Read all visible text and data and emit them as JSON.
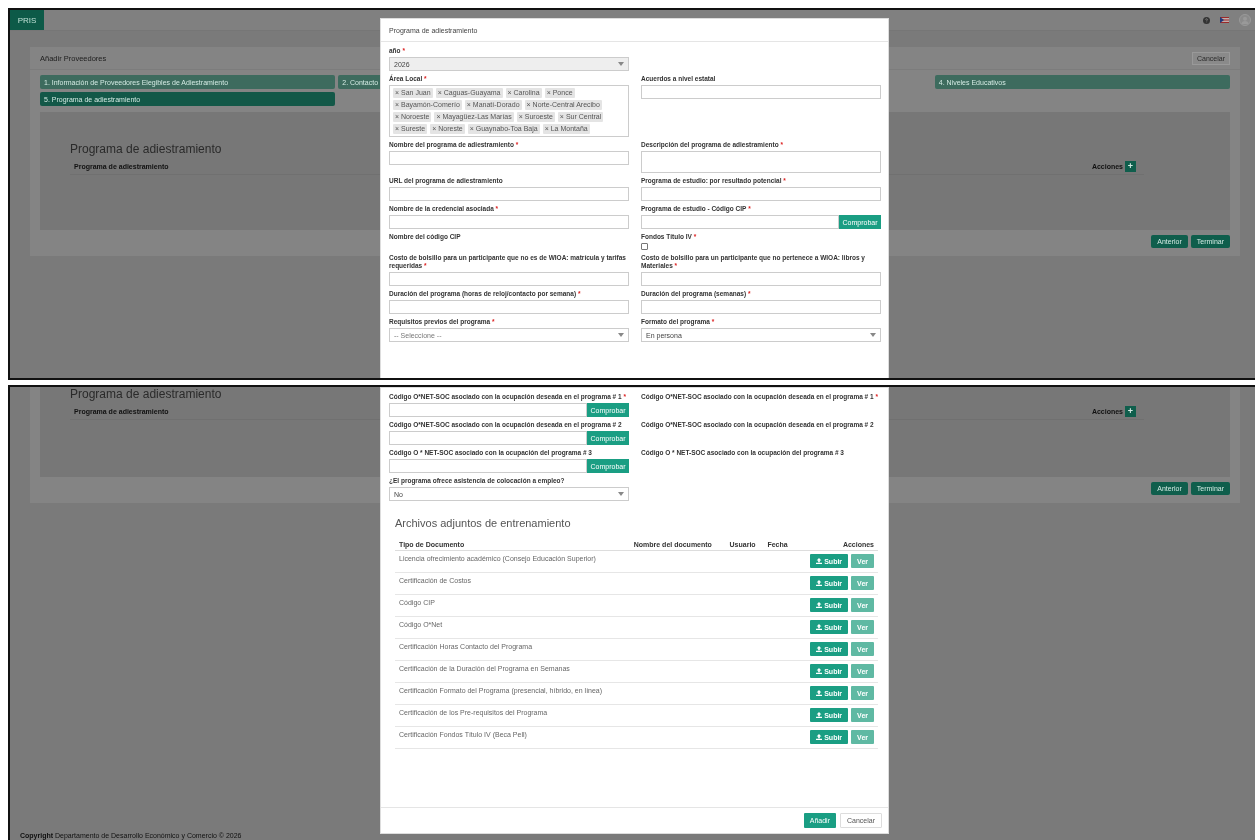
{
  "top_screen": {
    "navbar": {
      "brand": "PRIS"
    },
    "page": {
      "title": "Añadir Proveedores",
      "cancel_button": "Cancelar",
      "steps": [
        {
          "label": "1. Información de Proveedores Elegibles de Adiestramiento",
          "selected": false
        },
        {
          "label": "2. Contacto",
          "selected": false
        },
        {
          "label": "4. Niveles Educativos",
          "selected": false
        },
        {
          "label": "5. Programa de adiestramiento",
          "selected": true
        }
      ],
      "section_title": "Programa de adiestramiento",
      "table_header": "Programa de adiestramiento",
      "actions_label": "Acciones",
      "add_button": "+",
      "buttons": [
        "Anterior",
        "Terminar"
      ]
    },
    "modal": {
      "title": "Programa de adiestramiento",
      "rows": [
        {
          "fields": [
            {
              "kind": "select",
              "label": "año",
              "mark": "*",
              "value": "2026",
              "disabled": true
            }
          ]
        },
        {
          "fields": [
            {
              "kind": "tags",
              "label": "Área Local",
              "mark": "*",
              "tags": [
                {
                  "remove": "×",
                  "label": "San Juan"
                },
                {
                  "remove": "×",
                  "label": "Caguas-Guayama"
                },
                {
                  "remove": "×",
                  "label": "Carolina"
                },
                {
                  "remove": "×",
                  "label": "Ponce"
                },
                {
                  "remove": "×",
                  "label": "Bayamón-Comerío"
                },
                {
                  "remove": "×",
                  "label": "Manatí-Dorado"
                },
                {
                  "remove": "×",
                  "label": "Norte-Central Arecibo"
                },
                {
                  "remove": "×",
                  "label": "Noroeste"
                },
                {
                  "remove": "×",
                  "label": "Mayagüez-Las Marías"
                },
                {
                  "remove": "×",
                  "label": "Suroeste"
                },
                {
                  "remove": "×",
                  "label": "Sur Central"
                },
                {
                  "remove": "×",
                  "label": "Sureste"
                },
                {
                  "remove": "×",
                  "label": "Noreste"
                },
                {
                  "remove": "×",
                  "label": "Guaynabo-Toa Baja"
                },
                {
                  "remove": "×",
                  "label": "La Montaña"
                }
              ]
            },
            {
              "kind": "text",
              "label": "Acuerdos a nivel estatal"
            }
          ]
        },
        {
          "fields": [
            {
              "kind": "text",
              "label": "Nombre del programa de adiestramiento",
              "mark": "*"
            },
            {
              "kind": "textarea",
              "label": "Descripción del programa de adiestramiento",
              "mark": "*"
            }
          ]
        },
        {
          "fields": [
            {
              "kind": "text",
              "label": "URL del programa de adiestramiento"
            },
            {
              "kind": "text",
              "label": "Programa de estudio: por resultado potencial",
              "mark": "*"
            }
          ]
        },
        {
          "fields": [
            {
              "kind": "text",
              "label": "Nombre de la credencial asociada",
              "mark": "*"
            },
            {
              "kind": "text_button",
              "label": "Programa de estudio - Código CIP",
              "mark": "*",
              "button": "Comprobar"
            }
          ]
        },
        {
          "fields": [
            {
              "kind": "label",
              "label": "Nombre del código CIP"
            },
            {
              "kind": "checkbox",
              "label": "Fondos Título IV",
              "mark": "*",
              "checked": false
            }
          ]
        },
        {
          "fields": [
            {
              "kind": "text",
              "label": "Costo de bolsillo para un participante que no es de WIOA: matrícula y tarifas requeridas",
              "mark": "*"
            },
            {
              "kind": "text",
              "label": "Costo de bolsillo para un participante que no pertenece a WIOA: libros y Materiales",
              "mark": "*"
            }
          ]
        },
        {
          "fields": [
            {
              "kind": "text",
              "label": "Duración del programa (horas de reloj/contacto por semana)",
              "mark": "*"
            },
            {
              "kind": "text",
              "label": "Duración del programa (semanas)",
              "mark": "*"
            }
          ]
        },
        {
          "fields": [
            {
              "kind": "select",
              "label": "Requisitos previos del programa",
              "mark": "*",
              "placeholder": "-- Seleccione --"
            },
            {
              "kind": "select",
              "label": "Formato del programa",
              "mark": "*",
              "value": "En persona"
            }
          ]
        }
      ]
    }
  },
  "bottom_screen": {
    "page": {
      "section_title": "Programa de adiestramiento",
      "table_header": "Programa de adiestramiento",
      "actions_label": "Acciones",
      "add_button": "+",
      "buttons": [
        "Anterior",
        "Terminar"
      ]
    },
    "modal": {
      "rows": [
        {
          "fields": [
            {
              "kind": "text_button",
              "label": "Código O*NET-SOC asociado con la ocupación deseada en el programa # 1",
              "mark": "*",
              "button": "Comprobar"
            },
            {
              "kind": "label",
              "label": "Código O*NET-SOC asociado con la ocupación deseada en el programa # 1",
              "mark": "*"
            }
          ]
        },
        {
          "fields": [
            {
              "kind": "text_button",
              "label": "Código O*NET-SOC asociado con la ocupación deseada en el programa # 2",
              "button": "Comprobar"
            },
            {
              "kind": "label",
              "label": "Código O*NET-SOC asociado con la ocupación deseada en el programa # 2"
            }
          ]
        },
        {
          "fields": [
            {
              "kind": "text_button",
              "label": "Código O * NET-SOC asociado con la ocupación del programa # 3",
              "button": "Comprobar"
            },
            {
              "kind": "label",
              "label": "Código O * NET-SOC asociado con la ocupación del programa # 3"
            }
          ]
        },
        {
          "fields": [
            {
              "kind": "select",
              "label": "¿El programa ofrece asistencia de colocación a empleo?",
              "value": "No"
            }
          ]
        }
      ],
      "attachments": {
        "title": "Archivos adjuntos de entrenamiento",
        "columns": [
          "Tipo de Documento",
          "Nombre del documento",
          "Usuario",
          "Fecha",
          "Acciones"
        ],
        "rows": [
          {
            "type": "Licencia ofrecimiento académico (Consejo Educación Superior)",
            "buttons": [
              {
                "label": "Subir",
                "kind": "upload",
                "disabled": false
              },
              {
                "label": "Ver",
                "kind": "view",
                "disabled": true
              }
            ]
          },
          {
            "type": "Certificación de Costos",
            "buttons": [
              {
                "label": "Subir",
                "kind": "upload",
                "disabled": false
              },
              {
                "label": "Ver",
                "kind": "view",
                "disabled": true
              }
            ]
          },
          {
            "type": "Código CIP",
            "buttons": [
              {
                "label": "Subir",
                "kind": "upload",
                "disabled": false
              },
              {
                "label": "Ver",
                "kind": "view",
                "disabled": true
              }
            ]
          },
          {
            "type": "Código O*Net",
            "buttons": [
              {
                "label": "Subir",
                "kind": "upload",
                "disabled": false
              },
              {
                "label": "Ver",
                "kind": "view",
                "disabled": true
              }
            ]
          },
          {
            "type": "Certificación Horas Contacto del Programa",
            "buttons": [
              {
                "label": "Subir",
                "kind": "upload",
                "disabled": false
              },
              {
                "label": "Ver",
                "kind": "view",
                "disabled": true
              }
            ]
          },
          {
            "type": "Certificación de la Duración del Programa en Semanas",
            "buttons": [
              {
                "label": "Subir",
                "kind": "upload",
                "disabled": false
              },
              {
                "label": "Ver",
                "kind": "view",
                "disabled": true
              }
            ]
          },
          {
            "type": "Certificación Formato del Programa (presencial, híbrido, en línea)",
            "buttons": [
              {
                "label": "Subir",
                "kind": "upload",
                "disabled": false
              },
              {
                "label": "Ver",
                "kind": "view",
                "disabled": true
              }
            ]
          },
          {
            "type": "Certificación de los Pre-requisitos del Programa",
            "buttons": [
              {
                "label": "Subir",
                "kind": "upload",
                "disabled": false
              },
              {
                "label": "Ver",
                "kind": "view",
                "disabled": true
              }
            ]
          },
          {
            "type": "Certificación Fondos Título IV (Beca Pell)",
            "buttons": [
              {
                "label": "Subir",
                "kind": "upload",
                "disabled": false
              },
              {
                "label": "Ver",
                "kind": "view",
                "disabled": true
              }
            ]
          }
        ]
      },
      "footer_buttons": [
        {
          "label": "Añadir",
          "kind": "primary"
        },
        {
          "label": "Cancelar",
          "kind": "default"
        }
      ]
    },
    "footer": "**Copyright** Departamento de Desarrollo Económico y Comercio © 2026"
  }
}
